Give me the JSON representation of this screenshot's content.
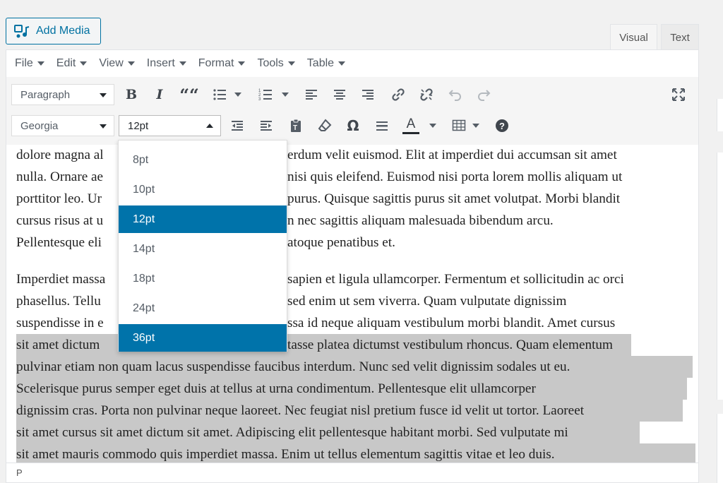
{
  "add_media": {
    "label": "Add Media",
    "icon": "media-icon"
  },
  "mode_tabs": {
    "visual": "Visual",
    "text": "Text"
  },
  "menubar": [
    "File",
    "Edit",
    "View",
    "Insert",
    "Format",
    "Tools",
    "Table"
  ],
  "toolbar": {
    "block_format": "Paragraph",
    "font_family": "Georgia",
    "font_size": "12pt",
    "row1_icons": [
      "bold-icon",
      "italic-icon",
      "blockquote-icon",
      "bullet-list-icon",
      "numbered-list-icon",
      "align-left-icon",
      "align-center-icon",
      "align-right-icon",
      "insert-link-icon",
      "remove-link-icon",
      "undo-icon",
      "redo-icon",
      "fullscreen-icon"
    ],
    "row2_icons": [
      "outdent-icon",
      "indent-icon",
      "paste-as-text-icon",
      "clear-formatting-icon",
      "special-character-icon",
      "horizontal-line-icon",
      "text-color-icon",
      "table-icon",
      "help-icon"
    ],
    "bold": "B",
    "italic": "I",
    "quote": "““",
    "omega": "Ω",
    "text_color": "A",
    "help": "?"
  },
  "font_size_options": [
    {
      "label": "8pt",
      "active": false
    },
    {
      "label": "10pt",
      "active": false
    },
    {
      "label": "12pt",
      "active": true
    },
    {
      "label": "14pt",
      "active": false
    },
    {
      "label": "18pt",
      "active": false
    },
    {
      "label": "24pt",
      "active": false
    },
    {
      "label": "36pt",
      "active": true
    }
  ],
  "content": {
    "para1": [
      "dolore magna al",
      "nulla. Ornare ae",
      "porttitor leo. Ur",
      "cursus risus at u",
      "Pellentesque eli"
    ],
    "para1_right": [
      "erdum velit euismod. Elit at imperdiet dui accumsan sit amet",
      "nisi quis eleifend. Euismod nisi porta lorem mollis aliquam ut",
      "purus. Quisque sagittis purus sit amet volutpat. Morbi blandit",
      "n nec sagittis aliquam malesuada bibendum arcu.",
      "atoque penatibus et."
    ],
    "para2_left": [
      "Imperdiet massa",
      "phasellus. Tellu",
      "suspendisse in e",
      "sit amet dictum"
    ],
    "para2_right": [
      "sapien et ligula ullamcorper. Fermentum et sollicitudin ac orci",
      "sed enim ut sem viverra. Quam vulputate dignissim",
      "ssa id neque aliquam vestibulum morbi blandit. Amet cursus",
      "tasse platea dictumst vestibulum rhoncus. Quam elementum"
    ],
    "para2_full": [
      "pulvinar etiam non quam lacus suspendisse faucibus interdum. Nunc sed velit dignissim sodales ut eu.",
      "Scelerisque purus semper eget duis at tellus at urna condimentum. Pellentesque elit ullamcorper",
      "dignissim cras. Porta non pulvinar neque laoreet. Nec feugiat nisl pretium fusce id velit ut tortor. Laoreet",
      "sit amet cursus sit amet dictum sit amet. Adipiscing elit pellentesque habitant morbi. Sed vulputate mi",
      "sit amet mauris commodo quis imperdiet massa. Enim ut tellus elementum sagittis vitae et leo duis."
    ]
  },
  "statusbar": {
    "path": "P"
  },
  "colors": {
    "accent": "#0073aa",
    "selection": "#c8c8c8",
    "button_border": "#0071a1"
  }
}
